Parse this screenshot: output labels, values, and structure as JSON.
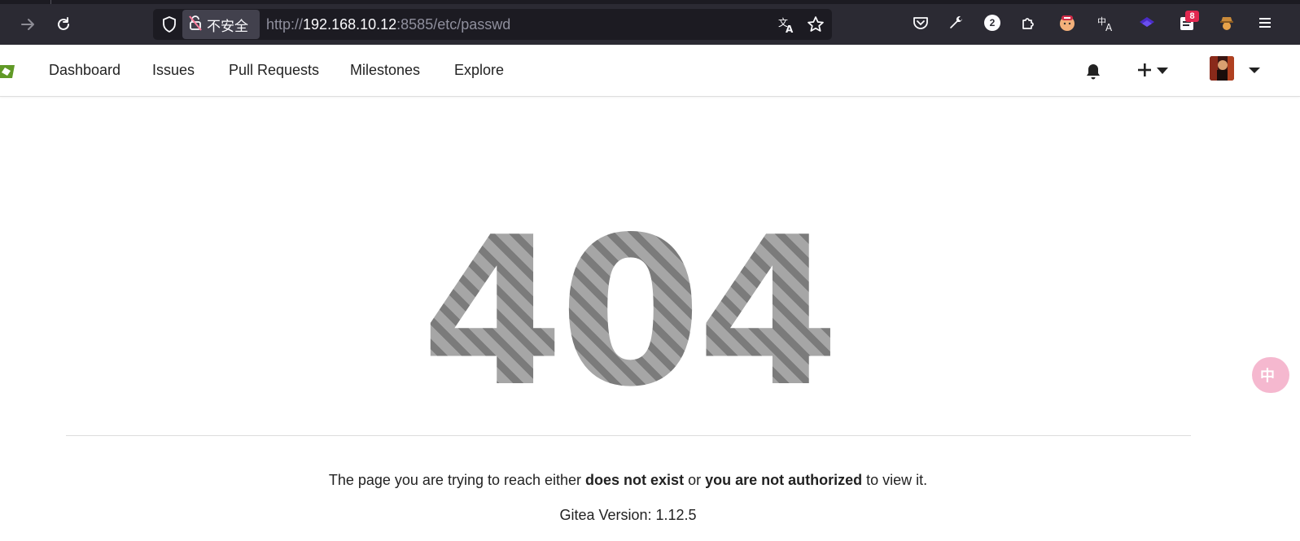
{
  "browser": {
    "insecure_label": "不安全",
    "url_scheme": "http://",
    "url_host": "192.168.10.12",
    "url_rest": ":8585/etc/passwd",
    "extension_badge_count": "2",
    "notification_badge_count": "8",
    "icons": [
      "back-arrow-icon",
      "forward-arrow-icon",
      "reload-icon",
      "shield-icon",
      "lock-insecure-icon",
      "translate-icon",
      "bookmark-star-icon",
      "pocket-icon",
      "wrench-icon",
      "extensions-icon",
      "hamburger-menu-icon"
    ]
  },
  "nav": {
    "items": [
      {
        "label": "Dashboard"
      },
      {
        "label": "Issues"
      },
      {
        "label": "Pull Requests"
      },
      {
        "label": "Milestones"
      },
      {
        "label": "Explore"
      }
    ],
    "brand_color": "#609926"
  },
  "error": {
    "code": "404",
    "message_prefix": "The page you are trying to reach either ",
    "message_bold_1": "does not exist",
    "message_mid": " or ",
    "message_bold_2": "you are not authorized",
    "message_suffix": " to view it.",
    "version_text": "Gitea Version: 1.12.5"
  },
  "floating": {
    "label": "中"
  }
}
